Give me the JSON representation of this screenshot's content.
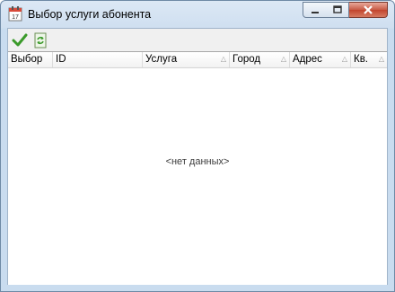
{
  "window": {
    "title": "Выбор услуги абонента"
  },
  "grid": {
    "columns": [
      {
        "label": "Выбор",
        "sortable": false
      },
      {
        "label": "ID",
        "sortable": false
      },
      {
        "label": "Услуга",
        "sortable": true
      },
      {
        "label": "Город",
        "sortable": true
      },
      {
        "label": "Адрес",
        "sortable": true
      },
      {
        "label": "Кв.",
        "sortable": true
      }
    ],
    "sort_glyph": "△",
    "empty_text": "<нет данных>"
  },
  "toolbar": {
    "icons": [
      "checkmark-icon",
      "refresh-icon"
    ]
  },
  "colors": {
    "accent_green": "#3a9a2a",
    "close_red": "#c75a45"
  }
}
